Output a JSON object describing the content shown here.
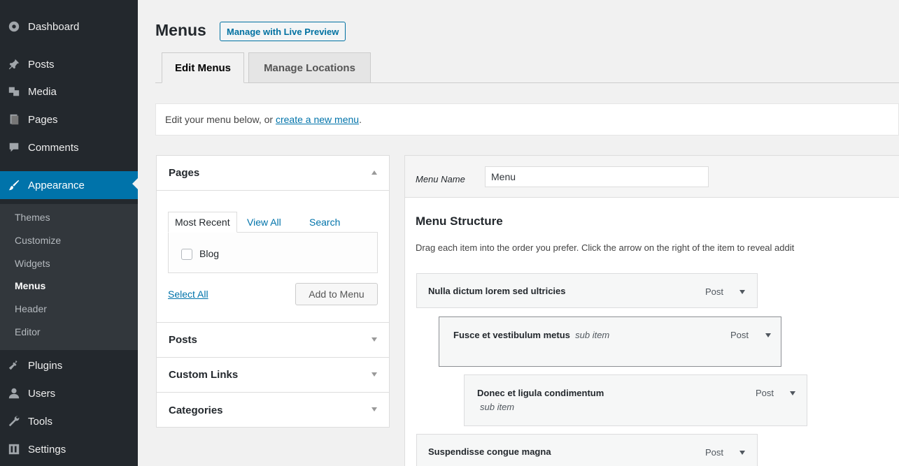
{
  "sidebar": {
    "items": [
      {
        "label": "Dashboard",
        "icon": "dashboard-icon"
      },
      {
        "label": "Posts",
        "icon": "pin-icon"
      },
      {
        "label": "Media",
        "icon": "media-icon"
      },
      {
        "label": "Pages",
        "icon": "pages-icon"
      },
      {
        "label": "Comments",
        "icon": "comments-icon"
      },
      {
        "label": "Appearance",
        "icon": "brush-icon"
      },
      {
        "label": "Plugins",
        "icon": "plug-icon"
      },
      {
        "label": "Users",
        "icon": "users-icon"
      },
      {
        "label": "Tools",
        "icon": "wrench-icon"
      },
      {
        "label": "Settings",
        "icon": "settings-icon"
      }
    ],
    "submenu": [
      "Themes",
      "Customize",
      "Widgets",
      "Menus",
      "Header",
      "Editor"
    ],
    "current_submenu": "Menus"
  },
  "header": {
    "title": "Menus",
    "live_preview": "Manage with Live Preview",
    "tabs": [
      "Edit Menus",
      "Manage Locations"
    ]
  },
  "notice": {
    "prefix": "Edit your menu below, or ",
    "link": "create a new menu",
    "suffix": "."
  },
  "accordion": {
    "sections": [
      "Pages",
      "Posts",
      "Custom Links",
      "Categories"
    ],
    "page_tabs": [
      "Most Recent",
      "View All",
      "Search"
    ],
    "page_item": "Blog",
    "select_all": "Select All",
    "add_to_menu": "Add to Menu"
  },
  "menu": {
    "name_label": "Menu Name",
    "name_value": "Menu",
    "structure_title": "Menu Structure",
    "structure_desc": "Drag each item into the order you prefer. Click the arrow on the right of the item to reveal addit",
    "items": [
      {
        "title": "Nulla dictum lorem sed ultricies",
        "sub": "",
        "type": "Post"
      },
      {
        "title": "Fusce et vestibulum metus",
        "sub": "sub item",
        "type": "Post"
      },
      {
        "title": "Donec et ligula condimentum",
        "sub": "sub item",
        "type": "Post"
      },
      {
        "title": "Suspendisse congue magna",
        "sub": "",
        "type": "Post"
      }
    ]
  },
  "colors": {
    "sidebar_bg": "#23282d",
    "submenu_bg": "#32373c",
    "accent": "#0073aa",
    "page_bg": "#f1f1f1"
  }
}
